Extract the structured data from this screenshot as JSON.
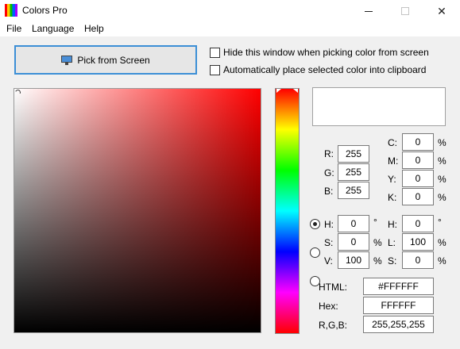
{
  "window": {
    "title": "Colors Pro",
    "controls": {
      "minimize": "minimize",
      "maximize": "maximize",
      "close": "✕"
    }
  },
  "menu": [
    "File",
    "Language",
    "Help"
  ],
  "pick_button": {
    "label": "Pick from Screen",
    "icon": "monitor-icon"
  },
  "options": [
    {
      "label": "Hide this window when picking color from screen",
      "checked": false
    },
    {
      "label": "Automatically place selected color into clipboard",
      "checked": false
    }
  ],
  "selected_color": "#FFFFFF",
  "hue_color": "#FF0000",
  "rgb": {
    "r": {
      "label": "R:",
      "value": "255"
    },
    "g": {
      "label": "G:",
      "value": "255"
    },
    "b": {
      "label": "B:",
      "value": "255"
    }
  },
  "cmyk": {
    "c": {
      "label": "C:",
      "value": "0",
      "unit": "%"
    },
    "m": {
      "label": "M:",
      "value": "0",
      "unit": "%"
    },
    "y": {
      "label": "Y:",
      "value": "0",
      "unit": "%"
    },
    "k": {
      "label": "K:",
      "value": "0",
      "unit": "%"
    }
  },
  "hsv": {
    "h": {
      "label": "H:",
      "value": "0",
      "unit": "°",
      "selected": true
    },
    "s": {
      "label": "S:",
      "value": "0",
      "unit": "%",
      "selected": false
    },
    "v": {
      "label": "V:",
      "value": "100",
      "unit": "%",
      "selected": false
    }
  },
  "hsl": {
    "h": {
      "label": "H:",
      "value": "0",
      "unit": "°"
    },
    "l": {
      "label": "L:",
      "value": "100",
      "unit": "%"
    },
    "s": {
      "label": "S:",
      "value": "0",
      "unit": "%"
    }
  },
  "codes": {
    "html": {
      "label": "HTML:",
      "value": "#FFFFFF"
    },
    "hex": {
      "label": "Hex:",
      "value": "FFFFFF"
    },
    "rgb": {
      "label": "R,G,B:",
      "value": "255,255,255"
    }
  }
}
